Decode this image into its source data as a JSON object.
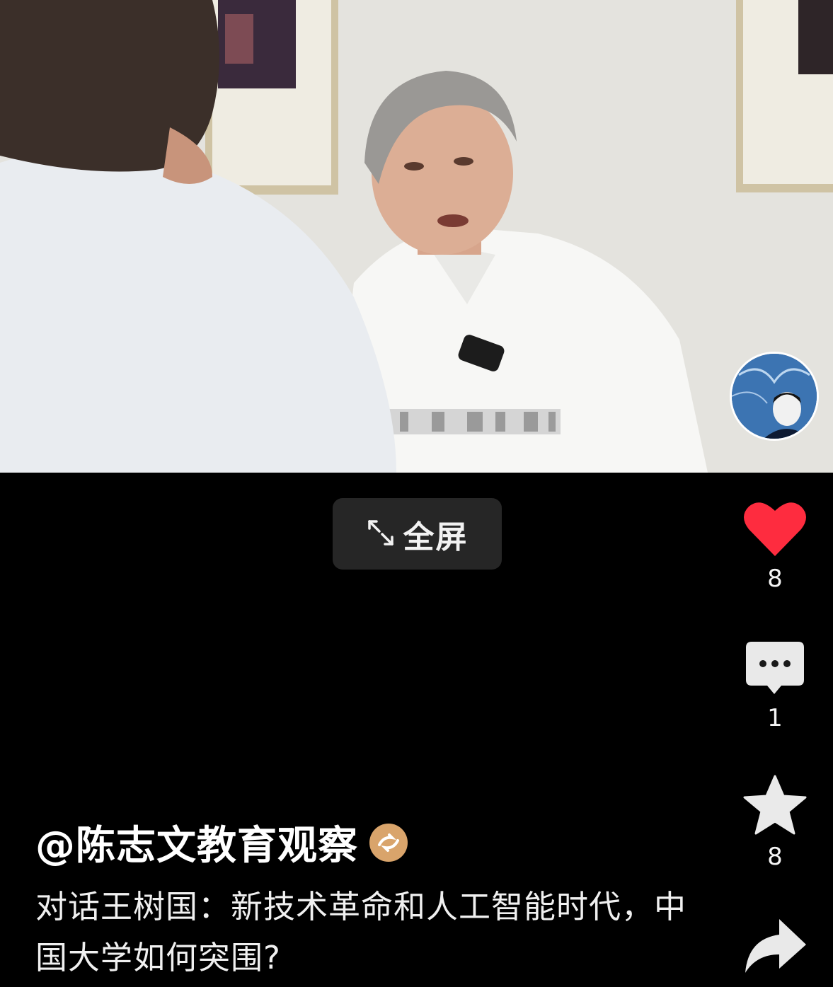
{
  "player": {
    "fullscreen_label": "全屏"
  },
  "actions": {
    "like_count": "8",
    "comment_count": "1",
    "favorite_count": "8",
    "like_color": "#fe2c3f"
  },
  "post": {
    "author": "@陈志文教育观察",
    "description": "对话王树国：新技术革命和人工智能时代，中国大学如何突围?"
  },
  "icons": {
    "fullscreen": "expand-arrows-icon",
    "like": "heart-icon",
    "comment": "speech-bubble-icon",
    "favorite": "star-icon",
    "share": "share-arrow-icon",
    "verified": "verified-badge-icon"
  }
}
